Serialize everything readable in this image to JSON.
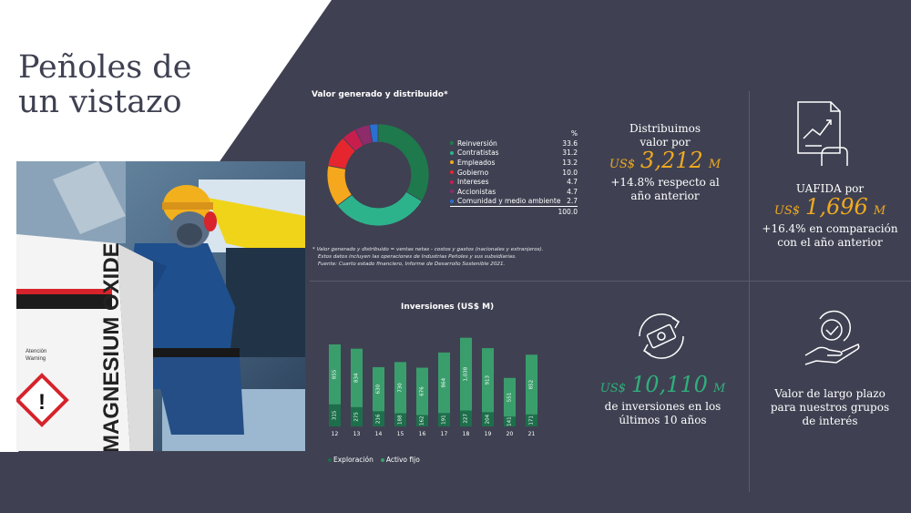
{
  "page": {
    "title_line1": "Peñoles de",
    "title_line2": "un vistazo"
  },
  "photo": {
    "bag_text": "MAGNESIUM OXIDE",
    "warning1": "Atención",
    "warning2": "Warning"
  },
  "colors": {
    "background": "#3f4152",
    "accent": "#f0a91f",
    "exploracion": "#1d6e4a",
    "activo_fijo": "#3a9e6c"
  },
  "valor": {
    "title": "Valor generado y distribuido*",
    "pct_header": "%",
    "total": "100.0",
    "note_line1": "* Valor generado y distribuido = ventas netas - costos y gastos (nacionales y extranjeros).",
    "note_line2": "Estos datos incluyen las operaciones de Industrias Peñoles y sus subsidiarias.",
    "note_line3": "Fuente: Cuarto estado financiero, Informe de Desarrollo Sostenible 2021."
  },
  "kpis": {
    "distribuimos": {
      "line1": "Distribuimos",
      "line2": "valor por",
      "currency": "US$",
      "amount": "3,212",
      "unit": "M",
      "change1": "+14.8% respecto al",
      "change2": "año anterior"
    },
    "uafida": {
      "line1": "UAFIDA por",
      "currency": "US$",
      "amount": "1,696",
      "unit": "M",
      "change1": "+16.4% en comparación",
      "change2": "con el año anterior"
    },
    "inversiones": {
      "currency": "US$",
      "amount": "10,110",
      "unit": "M",
      "line1": "de inversiones en los",
      "line2": "últimos 10 años"
    },
    "largo_plazo": {
      "line1": "Valor de largo plazo",
      "line2": "para nuestros grupos",
      "line3": "de interés"
    }
  },
  "chart_data": [
    {
      "type": "pie",
      "title": "Valor generado y distribuido*",
      "donut": true,
      "slices": [
        {
          "label": "Reinversión",
          "value": 33.6,
          "color": "#1e7a4c"
        },
        {
          "label": "Contratistas",
          "value": 31.2,
          "color": "#2db38c"
        },
        {
          "label": "Empleados",
          "value": 13.2,
          "color": "#f5a81d"
        },
        {
          "label": "Gobierno",
          "value": 10.0,
          "color": "#e6262f"
        },
        {
          "label": "Intereses",
          "value": 4.7,
          "color": "#c81e4e"
        },
        {
          "label": "Accionistas",
          "value": 4.7,
          "color": "#8e2b6a"
        },
        {
          "label": "Comunidad y medio ambiente",
          "value": 2.7,
          "color": "#2a6fd1"
        }
      ],
      "value_labels": [
        "33.6",
        "31.2",
        "13.2",
        "10.0",
        "4.7",
        "4.7",
        "2.7"
      ]
    },
    {
      "type": "bar",
      "stacked": true,
      "title": "Inversiones (US$ M)",
      "categories": [
        "12",
        "13",
        "14",
        "15",
        "16",
        "17",
        "18",
        "19",
        "20",
        "21"
      ],
      "series": [
        {
          "name": "Exploración",
          "values": [
            315,
            275,
            216,
            188,
            162,
            191,
            227,
            204,
            141,
            171
          ],
          "labels": [
            "315",
            "275",
            "216",
            "188",
            "162",
            "191",
            "227",
            "204",
            "141",
            "171"
          ],
          "color": "#1d6e4a"
        },
        {
          "name": "Activo fijo",
          "values": [
            855,
            834,
            630,
            730,
            676,
            864,
            1038,
            913,
            551,
            852
          ],
          "labels": [
            "855",
            "834",
            "630",
            "730",
            "676",
            "864",
            "1,038",
            "913",
            "551",
            "852"
          ],
          "color": "#3a9e6c"
        }
      ],
      "ylim": [
        0,
        1300
      ]
    }
  ]
}
